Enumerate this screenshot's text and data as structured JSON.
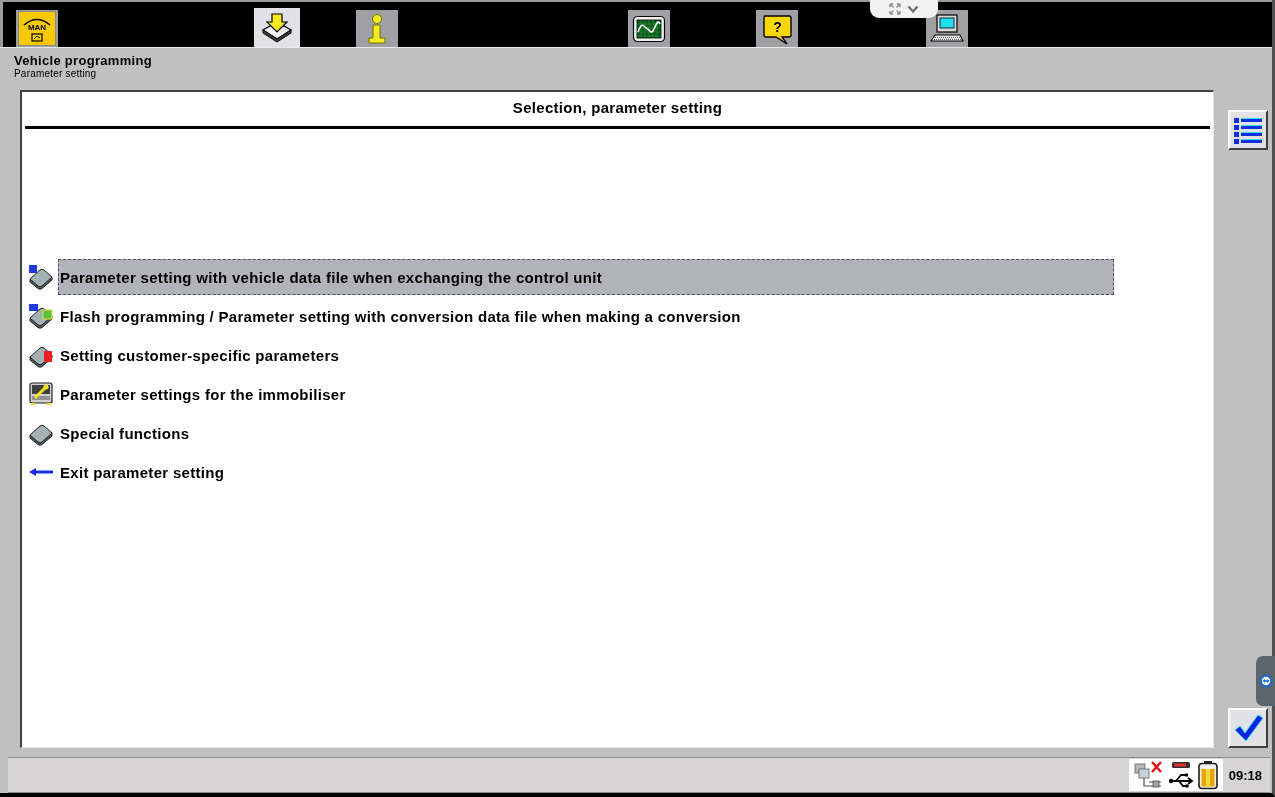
{
  "toolbar": {
    "tabs": [
      {
        "kind": "logo",
        "text": "MAN",
        "selected": false
      },
      {
        "kind": "download",
        "selected": true
      },
      {
        "kind": "info",
        "selected": false
      },
      {
        "kind": "measurement",
        "selected": false
      },
      {
        "kind": "help",
        "text": "?",
        "selected": false
      },
      {
        "kind": "computer",
        "selected": false
      }
    ]
  },
  "header": {
    "title": "Vehicle programming",
    "subtitle": "Parameter setting"
  },
  "panel": {
    "title": "Selection, parameter setting",
    "items": [
      {
        "kind": "data-file",
        "label": "Parameter setting with vehicle data file when exchanging the control unit",
        "selected": true
      },
      {
        "kind": "conversion",
        "label": "Flash programming / Parameter setting with conversion data file when making a conversion",
        "selected": false
      },
      {
        "kind": "customer",
        "label": "Setting customer-specific parameters",
        "selected": false
      },
      {
        "kind": "immobiliser",
        "label": "Parameter settings for the immobiliser",
        "selected": false
      },
      {
        "kind": "special",
        "label": "Special functions",
        "selected": false
      },
      {
        "kind": "exit",
        "label": "Exit parameter setting",
        "selected": false
      }
    ]
  },
  "status_bar": {
    "time": "09:18"
  }
}
